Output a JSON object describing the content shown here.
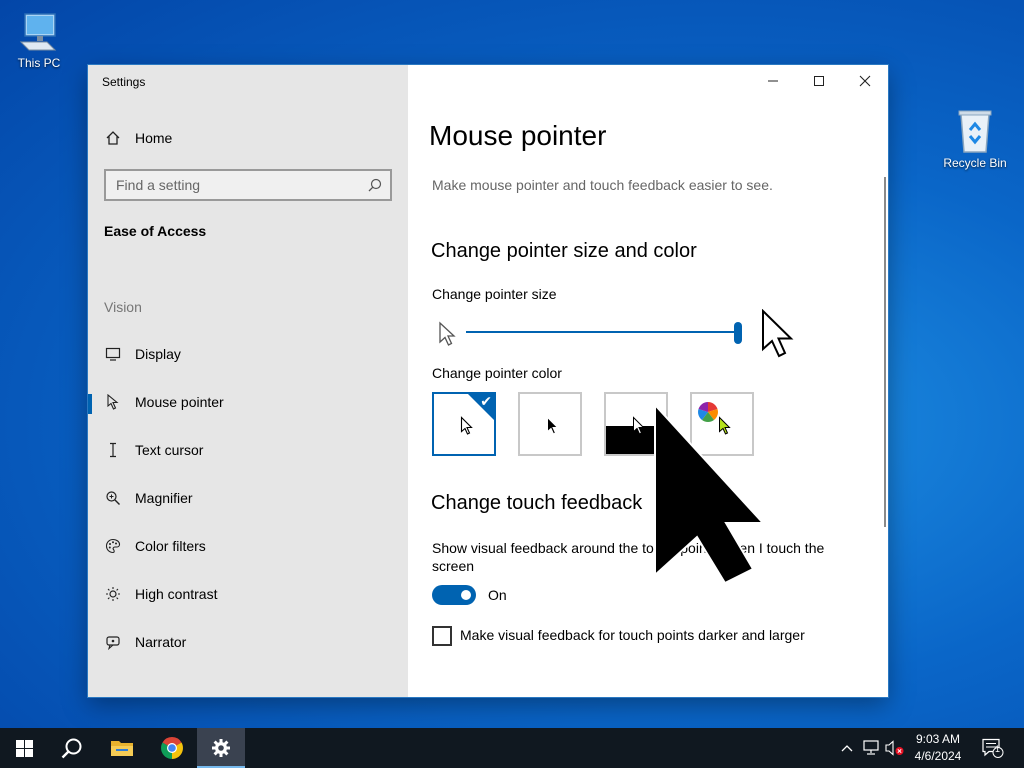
{
  "desktop": {
    "icons": [
      {
        "label": "This PC",
        "icon": "computer-icon"
      },
      {
        "label": "Recycle Bin",
        "icon": "recycle-bin-icon"
      }
    ]
  },
  "window": {
    "title": "Settings",
    "caption_buttons": [
      "minimize",
      "maximize",
      "close"
    ]
  },
  "sidebar": {
    "home_label": "Home",
    "search_placeholder": "Find a setting",
    "section_title": "Ease of Access",
    "group_label": "Vision",
    "items": [
      {
        "label": "Display",
        "icon": "monitor-icon",
        "active": false
      },
      {
        "label": "Mouse pointer",
        "icon": "mouse-pointer-icon",
        "active": true
      },
      {
        "label": "Text cursor",
        "icon": "text-cursor-icon",
        "active": false
      },
      {
        "label": "Magnifier",
        "icon": "magnifier-icon",
        "active": false
      },
      {
        "label": "Color filters",
        "icon": "color-palette-icon",
        "active": false
      },
      {
        "label": "High contrast",
        "icon": "sun-icon",
        "active": false
      },
      {
        "label": "Narrator",
        "icon": "narrator-icon",
        "active": false
      }
    ]
  },
  "main": {
    "title": "Mouse pointer",
    "description": "Make mouse pointer and touch feedback easier to see.",
    "pointer_section_heading": "Change pointer size and color",
    "size_label": "Change pointer size",
    "size_slider_fraction": 1.0,
    "color_label": "Change pointer color",
    "color_options": [
      {
        "name": "white",
        "selected": true
      },
      {
        "name": "black",
        "selected": false
      },
      {
        "name": "inverted",
        "selected": false
      },
      {
        "name": "custom",
        "selected": false
      }
    ],
    "touch_section_heading": "Change touch feedback",
    "touch_description": "Show visual feedback around the touch points when I touch the screen",
    "touch_toggle_state": "On",
    "darker_checkbox_label": "Make visual feedback for touch points darker and larger",
    "darker_checkbox_checked": false
  },
  "taskbar": {
    "apps": [
      {
        "name": "start",
        "icon": "windows-logo-icon"
      },
      {
        "name": "search",
        "icon": "search-icon"
      },
      {
        "name": "file-explorer",
        "icon": "folder-icon"
      },
      {
        "name": "chrome",
        "icon": "chrome-icon"
      },
      {
        "name": "settings",
        "icon": "gear-icon",
        "active": true
      }
    ],
    "tray_icons": [
      "chevron-up-icon",
      "network-icon",
      "volume-muted-icon"
    ],
    "time": "9:03 AM",
    "date": "4/6/2024",
    "notification_count": "1"
  },
  "colors": {
    "accent": "#0063b1",
    "sidebar_bg": "#e6e6e6",
    "taskbar_bg": "#101820"
  }
}
